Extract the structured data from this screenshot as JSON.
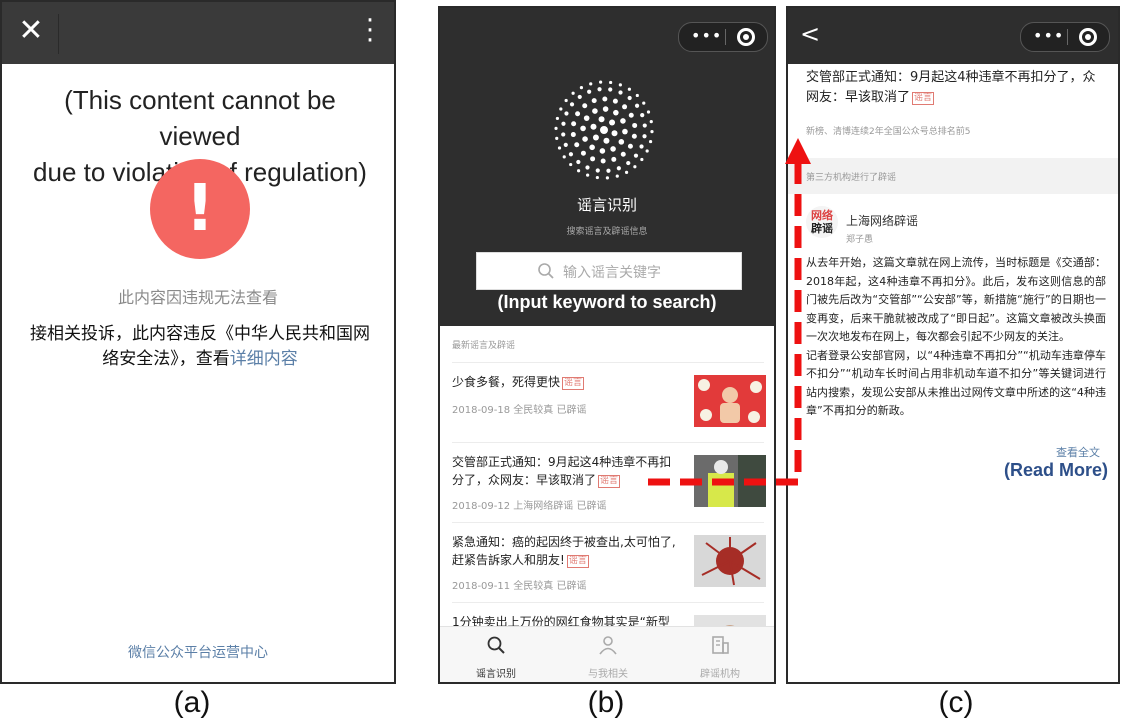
{
  "panel_a": {
    "annotation_line1": "(This content cannot be viewed",
    "annotation_line2": "due to violation of regulation)",
    "alert_glyph": "!",
    "message": "此内容因违规无法查看",
    "notice_text": "接相关投诉，此内容违反《中华人民共和国网络安全法》，查看",
    "notice_link": "详细内容",
    "footer": "微信公众平台运营中心",
    "caption": "(a)"
  },
  "panel_b": {
    "title": "谣言识别",
    "subtitle": "搜索谣言及辟谣信息",
    "search_placeholder": "输入谣言关键字",
    "annotation": "(Input keyword to search)",
    "section_header": "最新谣言及辟谣",
    "rumor_tag": "谣言",
    "items": [
      {
        "title": "少食多餐，死得更快",
        "meta": "2018-09-18  全民较真  已辟谣"
      },
      {
        "title": "交管部正式通知：9月起这4种违章不再扣分了，众网友：早该取消了",
        "meta": "2018-09-12  上海网络辟谣  已辟谣"
      },
      {
        "title": "紧急通知：癌的起因终于被查出,太可怕了,赶紧告訴家人和朋友!",
        "meta": "2018-09-11  全民较真  已辟谣"
      },
      {
        "title": "1分钟卖出上万份的网红食物其实是“新型毒",
        "meta": ""
      }
    ],
    "tabs": [
      "谣言识别",
      "与我相关",
      "辟谣机构"
    ],
    "caption": "(b)"
  },
  "panel_c": {
    "back_glyph": "<",
    "title": "交管部正式通知：9月起这4种违章不再扣分了，众网友：早该取消了",
    "rumor_tag": "谣言",
    "subtitle": "新榜、清博连续2年全国公众号总排名前5",
    "band_text": "第三方机构进行了辟谣",
    "avatar_line1": "网络",
    "avatar_line2": "辟谣",
    "org_name": "上海网络辟谣",
    "author": "郑子愚",
    "paragraph1": "从去年开始，这篇文章就在网上流传，当时标题是《交通部：2018年起，这4种违章不再扣分》。此后，发布这则信息的部门被先后改为“交管部”“公安部”等，新措施“施行”的日期也一变再变，后来干脆就被改成了“即日起”。这篇文章被改头换面一次次地发布在网上，每次都会引起不少网友的关注。",
    "paragraph2": "记者登录公安部官网，以“4种违章不再扣分”“机动车违章停车不扣分”“机动车长时间占用非机动车道不扣分”等关键词进行站内搜索，发现公安部从未推出过网传文章中所述的这“4种违章”不再扣分的新政。",
    "read_more": "查看全文",
    "annotation": "(Read More)",
    "caption": "(c)"
  },
  "colors": {
    "alert_red": "#f46661",
    "link_blue": "#5b7fa7",
    "dark_bar": "#2e2e2e",
    "annotation_blue": "#2d4f89",
    "arrow_red": "#ee1111"
  },
  "icons": [
    "close-icon",
    "more-vertical-icon",
    "more-dots-icon",
    "target-icon",
    "radial-dots-logo-icon",
    "search-icon",
    "user-icon",
    "building-icon",
    "back-chevron-icon"
  ]
}
